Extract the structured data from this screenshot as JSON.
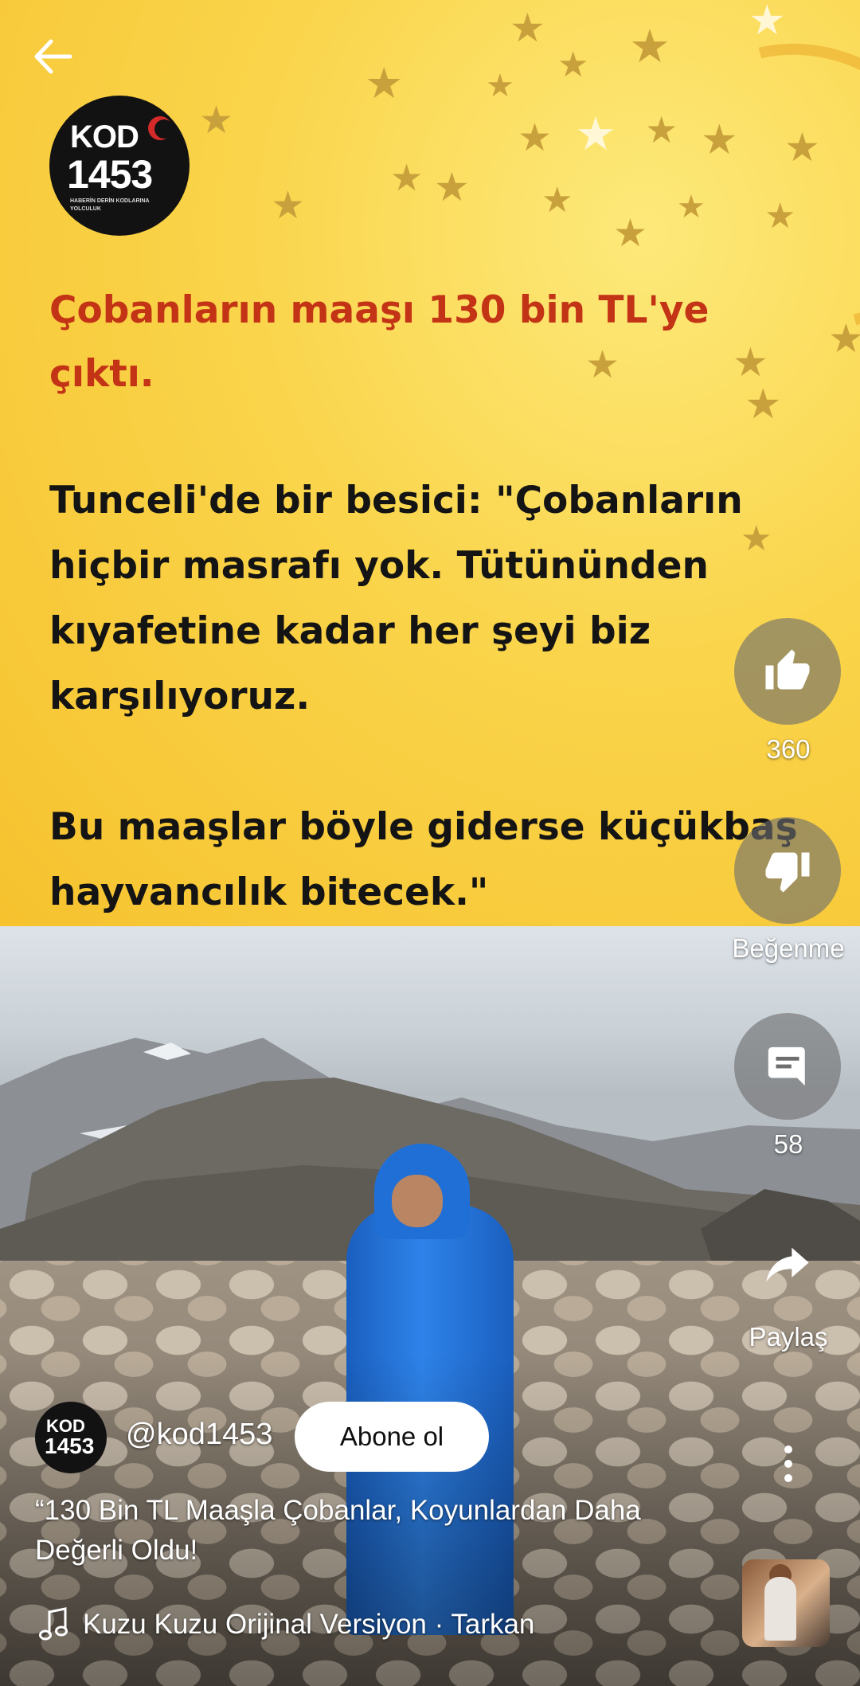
{
  "nav": {
    "back_icon": "arrow-left-icon"
  },
  "post": {
    "logo_kod": "KOD",
    "logo_number": "1453",
    "logo_tagline": "HABERİN DERİN KODLARINA YOLCULUK",
    "headline": "Çobanların maaşı 130 bin TL'ye çıktı.",
    "quote_part1": "Tunceli'de bir besici: \"Çobanların hiçbir masrafı yok. Tütününden kıyafetine kadar her şeyi biz karşılıyoruz.",
    "quote_part2": "Bu maaşlar böyle giderse küçükbaş hayvancılık bitecek.\"",
    "headline_color": "#c33316",
    "background_color": "#fad44a"
  },
  "actions": {
    "like_count": "360",
    "dislike_label": "Beğenme",
    "comments_count": "58",
    "share_label": "Paylaş"
  },
  "channel": {
    "avatar_kod": "KOD",
    "avatar_number": "1453",
    "handle": "@kod1453",
    "subscribe_label": "Abone ol"
  },
  "video": {
    "title": "“130 Bin TL Maaşla Çobanlar, Koyunlardan Daha Değerli Oldu!"
  },
  "music": {
    "text": "Kuzu Kuzu Orijinal Versiyon · Tarkan",
    "icon": "music-note-icon"
  },
  "icons": {
    "like": "thumbs-up-icon",
    "dislike": "thumbs-down-icon",
    "comments": "comment-icon",
    "share": "share-icon",
    "more": "more-vertical-icon"
  },
  "colors": {
    "overlay_button": "#6e6e6e",
    "cape": "#1f6fd6"
  }
}
